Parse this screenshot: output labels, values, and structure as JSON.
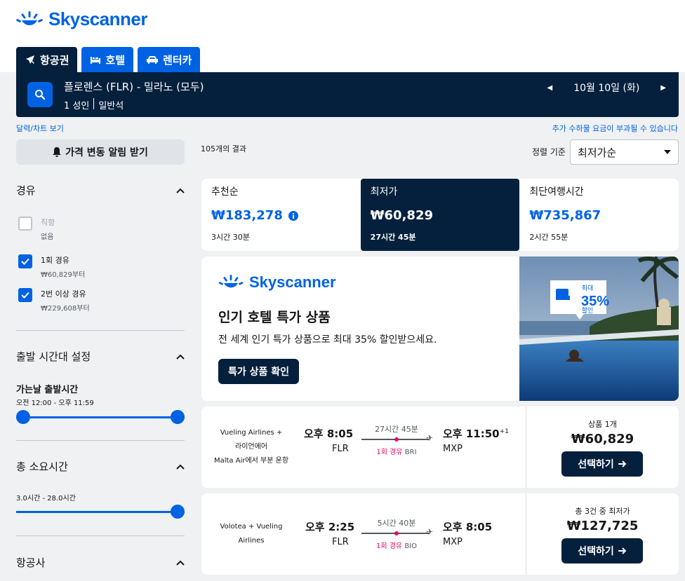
{
  "brand": {
    "name": "Skyscanner",
    "color": "#0062e3"
  },
  "tabs": [
    {
      "label": "항공권",
      "icon": "plane-icon",
      "active": true
    },
    {
      "label": "호텔",
      "icon": "bed-icon",
      "active": false
    },
    {
      "label": "렌터카",
      "icon": "car-icon",
      "active": false
    }
  ],
  "search": {
    "route": "플로렌스 (FLR) - 밀라노 (모두)",
    "passengers": "1 성인",
    "cabin": "일반석",
    "date": "10월 10일 (화)"
  },
  "links": {
    "calendar": "달력/차트 보기",
    "fees": "추가 수하물 요금이 부과될 수 있습니다"
  },
  "alert_button": "가격 변동 알림 받기",
  "filters": {
    "stops": {
      "title": "경유",
      "options": [
        {
          "label": "직항",
          "sub": "없음",
          "checked": false,
          "disabled": true
        },
        {
          "label": "1회 경유",
          "sub": "₩60,829부터",
          "checked": true,
          "disabled": false
        },
        {
          "label": "2번 이상 경유",
          "sub": "₩229,608부터",
          "checked": true,
          "disabled": false
        }
      ]
    },
    "departure": {
      "title": "출발 시간대 설정",
      "subtitle": "가는날 출발시간",
      "range": "오전 12:00 - 오후 11:59"
    },
    "duration": {
      "title": "총 소요시간",
      "range": "3.0시간 - 28.0시간"
    },
    "airlines": {
      "title": "항공사"
    }
  },
  "results": {
    "count": "105개의 결과",
    "sort_label": "정렬 기준",
    "sort_value": "최저가순"
  },
  "sort_tabs": [
    {
      "label": "추천순",
      "price": "₩183,278",
      "duration": "3시간 30분",
      "active": false
    },
    {
      "label": "최저가",
      "price": "₩60,829",
      "duration": "27시간 45분",
      "active": true
    },
    {
      "label": "최단여행시간",
      "price": "₩735,867",
      "duration": "2시간 55분",
      "active": false
    }
  ],
  "ad": {
    "logo": "Skyscanner",
    "title": "인기 호텔 특가 상품",
    "description": "전 세계 인기 특가 상품으로 최대 35% 할인받으세요.",
    "button": "특가 상품 확인",
    "badge_top": "최대",
    "badge_pct": "35%",
    "badge_bottom": "할인"
  },
  "flights": [
    {
      "airline_1": "Vueling Airlines +",
      "airline_2": "라이언에어",
      "airline_3": "Malta Air에서 부분 운항",
      "dep_time": "오후 8:05",
      "dep_code": "FLR",
      "duration": "27시간 45분",
      "stops": "1회 경유",
      "stop_code": "BRI",
      "arr_time": "오후 11:50",
      "arr_offset": "+1",
      "arr_code": "MXP",
      "deal": "상품 1개",
      "price": "₩60,829",
      "select": "선택하기"
    },
    {
      "airline_1": "Volotea + Vueling",
      "airline_2": "Airlines",
      "airline_3": "",
      "dep_time": "오후 2:25",
      "dep_code": "FLR",
      "duration": "5시간 40분",
      "stops": "1회 경유",
      "stop_code": "BIO",
      "arr_time": "오후 8:05",
      "arr_offset": "",
      "arr_code": "MXP",
      "deal": "총 3건 중 최저가",
      "price": "₩127,725",
      "select": "선택하기"
    }
  ]
}
